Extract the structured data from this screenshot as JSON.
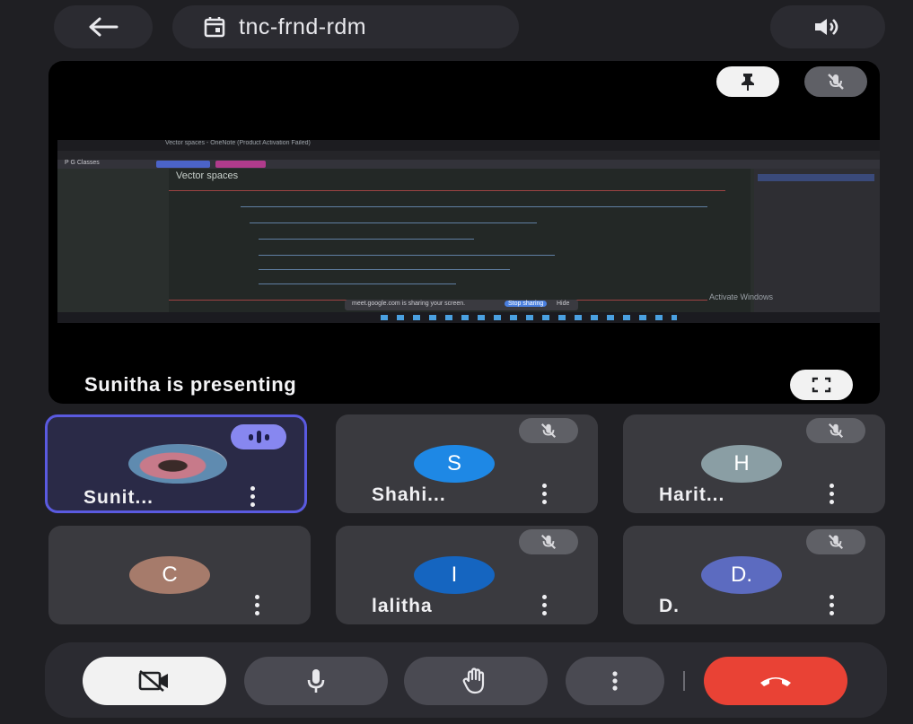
{
  "header": {
    "meeting_code": "tnc-frnd-rdm"
  },
  "stage": {
    "presenting_text": "Sunitha is presenting",
    "shared_screen": {
      "window_title": "Vector spaces - OneNote (Product Activation Failed)",
      "notebook": "P G Classes",
      "page_title": "Vector spaces",
      "activate_windows": "Activate Windows",
      "sharing_banner": "meet.google.com is sharing your screen.",
      "stop_sharing": "Stop sharing",
      "hide": "Hide"
    }
  },
  "participants": [
    {
      "name": "Sunit...",
      "initial": "",
      "avatar_color": "#c77a8a",
      "speaking": true,
      "muted": false
    },
    {
      "name": "Shahi...",
      "initial": "S",
      "avatar_color": "#1e88e5",
      "speaking": false,
      "muted": true
    },
    {
      "name": "Harit...",
      "initial": "H",
      "avatar_color": "#8a9ea4",
      "speaking": false,
      "muted": true
    },
    {
      "name": "",
      "initial": "C",
      "avatar_color": "#a67b6b",
      "speaking": false,
      "muted": false
    },
    {
      "name": "lalitha",
      "initial": "I",
      "avatar_color": "#1565c0",
      "speaking": false,
      "muted": true
    },
    {
      "name": "D.",
      "initial": "D.",
      "avatar_color": "#5c6bc0",
      "speaking": false,
      "muted": true
    }
  ],
  "controls": {
    "end_call_color": "#e94235"
  }
}
